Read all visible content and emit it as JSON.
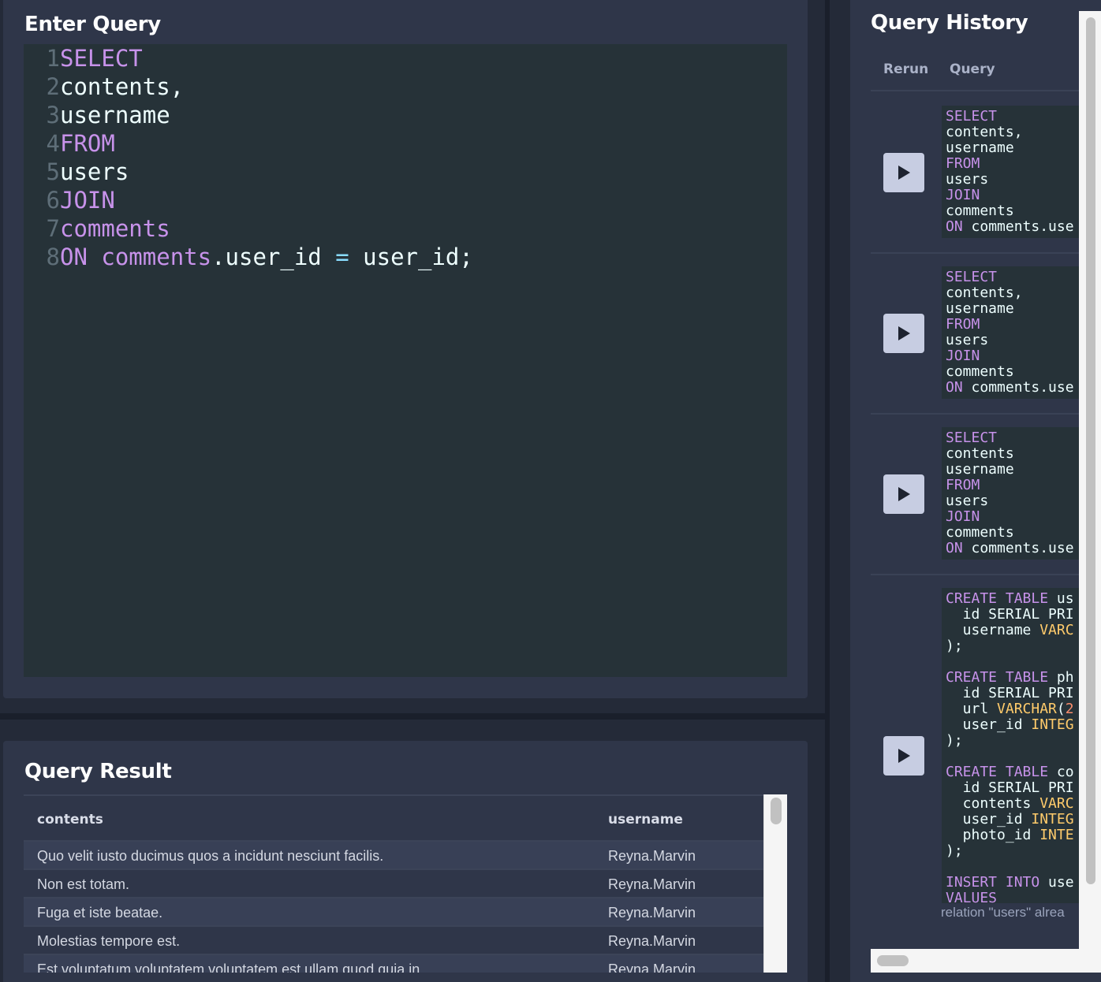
{
  "query_panel": {
    "title": "Enter Query",
    "lines": [
      {
        "num": "1",
        "tokens": [
          {
            "t": "SELECT",
            "k": "kw"
          }
        ]
      },
      {
        "num": "2",
        "tokens": [
          {
            "t": "contents,",
            "k": "plain"
          }
        ]
      },
      {
        "num": "3",
        "tokens": [
          {
            "t": "username",
            "k": "plain"
          }
        ]
      },
      {
        "num": "4",
        "tokens": [
          {
            "t": "FROM",
            "k": "kw"
          }
        ]
      },
      {
        "num": "5",
        "tokens": [
          {
            "t": "users",
            "k": "plain"
          }
        ]
      },
      {
        "num": "6",
        "tokens": [
          {
            "t": "JOIN",
            "k": "kw"
          }
        ]
      },
      {
        "num": "7",
        "tokens": [
          {
            "t": "comments",
            "k": "kw"
          }
        ]
      },
      {
        "num": "8",
        "tokens": [
          {
            "t": "ON",
            "k": "kw"
          },
          {
            "t": " ",
            "k": "plain"
          },
          {
            "t": "comments",
            "k": "kw"
          },
          {
            "t": ".user_id ",
            "k": "plain"
          },
          {
            "t": "=",
            "k": "op"
          },
          {
            "t": " user_id;",
            "k": "plain"
          }
        ]
      }
    ]
  },
  "result_panel": {
    "title": "Query Result",
    "columns": [
      "contents",
      "username"
    ],
    "rows": [
      [
        "Quo velit iusto ducimus quos a incidunt nesciunt facilis.",
        "Reyna.Marvin"
      ],
      [
        "Non est totam.",
        "Reyna.Marvin"
      ],
      [
        "Fuga et iste beatae.",
        "Reyna.Marvin"
      ],
      [
        "Molestias tempore est.",
        "Reyna.Marvin"
      ],
      [
        "Est voluptatum voluptatem voluptatem est ullam quod quia in.",
        "Reyna.Marvin"
      ]
    ]
  },
  "history_panel": {
    "title": "Query History",
    "col_rerun": "Rerun",
    "col_query": "Query",
    "entries": [
      {
        "lines": [
          [
            [
              "SELECT",
              "kw"
            ]
          ],
          [
            [
              "contents,",
              ""
            ]
          ],
          [
            [
              "username",
              ""
            ]
          ],
          [
            [
              "FROM",
              "kw"
            ]
          ],
          [
            [
              "users",
              ""
            ]
          ],
          [
            [
              "JOIN",
              "kw"
            ]
          ],
          [
            [
              "comments",
              ""
            ]
          ],
          [
            [
              "ON",
              "kw"
            ],
            [
              " comments.use",
              ""
            ]
          ]
        ]
      },
      {
        "lines": [
          [
            [
              "SELECT",
              "kw"
            ]
          ],
          [
            [
              "contents,",
              ""
            ]
          ],
          [
            [
              "username",
              ""
            ]
          ],
          [
            [
              "FROM",
              "kw"
            ]
          ],
          [
            [
              "users",
              ""
            ]
          ],
          [
            [
              "JOIN",
              "kw"
            ]
          ],
          [
            [
              "comments",
              ""
            ]
          ],
          [
            [
              "ON",
              "kw"
            ],
            [
              " comments.use",
              ""
            ]
          ]
        ]
      },
      {
        "lines": [
          [
            [
              "SELECT",
              "kw"
            ]
          ],
          [
            [
              "contents",
              ""
            ]
          ],
          [
            [
              "username",
              ""
            ]
          ],
          [
            [
              "FROM",
              "kw"
            ]
          ],
          [
            [
              "users",
              ""
            ]
          ],
          [
            [
              "JOIN",
              "kw"
            ]
          ],
          [
            [
              "comments",
              ""
            ]
          ],
          [
            [
              "ON",
              "kw"
            ],
            [
              " comments.use",
              ""
            ]
          ]
        ]
      },
      {
        "lines": [
          [
            [
              "CREATE TABLE",
              "kw"
            ],
            [
              " us",
              ""
            ]
          ],
          [
            [
              "  id SERIAL PRI",
              ""
            ]
          ],
          [
            [
              "  username ",
              ""
            ],
            [
              "VARC",
              "ty"
            ]
          ],
          [
            [
              ");",
              ""
            ]
          ],
          [
            [
              "",
              ""
            ]
          ],
          [
            [
              "CREATE TABLE",
              "kw"
            ],
            [
              " ph",
              ""
            ]
          ],
          [
            [
              "  id SERIAL PRI",
              ""
            ]
          ],
          [
            [
              "  url ",
              ""
            ],
            [
              "VARCHAR",
              "ty"
            ],
            [
              "(",
              ""
            ],
            [
              "2",
              "num"
            ]
          ],
          [
            [
              "  user_id ",
              ""
            ],
            [
              "INTEG",
              "ty"
            ]
          ],
          [
            [
              ");",
              ""
            ]
          ],
          [
            [
              "",
              ""
            ]
          ],
          [
            [
              "CREATE TABLE",
              "kw"
            ],
            [
              " co",
              ""
            ]
          ],
          [
            [
              "  id SERIAL PRI",
              ""
            ]
          ],
          [
            [
              "  contents ",
              ""
            ],
            [
              "VARC",
              "ty"
            ]
          ],
          [
            [
              "  user_id ",
              ""
            ],
            [
              "INTEG",
              "ty"
            ]
          ],
          [
            [
              "  photo_id ",
              ""
            ],
            [
              "INTE",
              "ty"
            ]
          ],
          [
            [
              ");",
              ""
            ]
          ],
          [
            [
              "",
              ""
            ]
          ],
          [
            [
              "INSERT INTO",
              "kw"
            ],
            [
              " use",
              ""
            ]
          ],
          [
            [
              "VALUES",
              "kw"
            ]
          ]
        ]
      }
    ],
    "error_text": "relation \"users\" alrea"
  },
  "icons": {
    "run": "play-icon"
  }
}
